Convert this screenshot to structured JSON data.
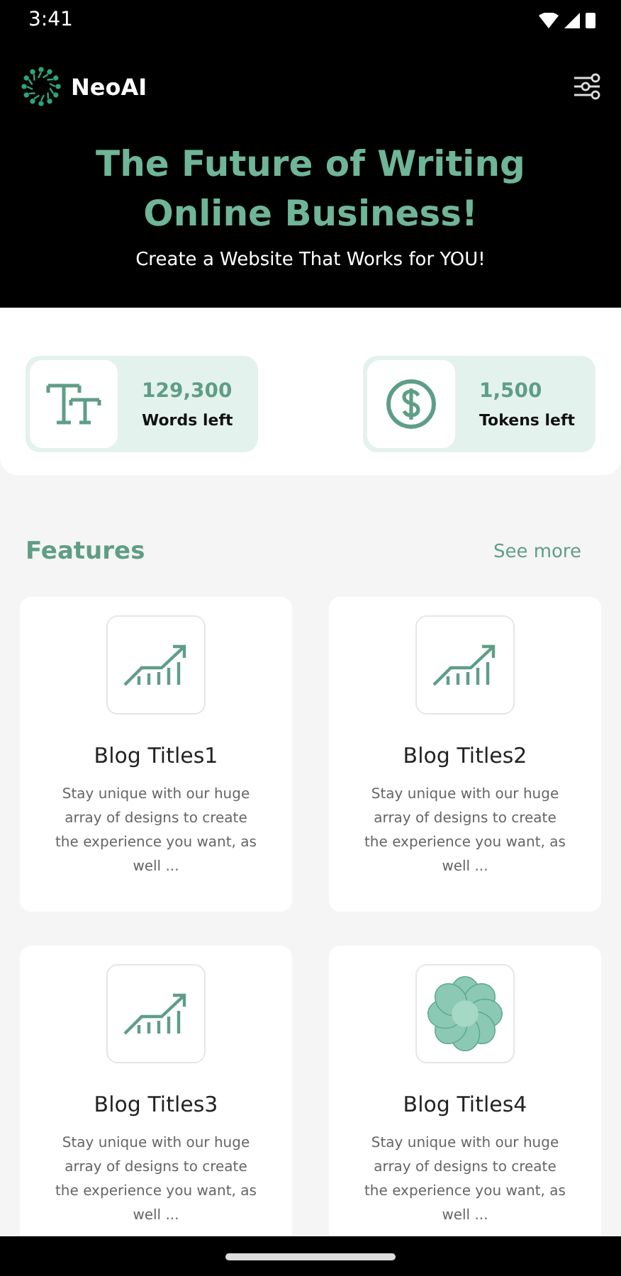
{
  "status_bar": {
    "time": "3:41"
  },
  "header": {
    "brand": "NeoAI",
    "headline": "The Future of Writing Online Business!",
    "tagline": "Create a Website That Works for YOU!"
  },
  "stats": [
    {
      "kind": "text",
      "value": "129,300",
      "label": "Words left"
    },
    {
      "kind": "dollar",
      "value": "1,500",
      "label": "Tokens left"
    }
  ],
  "features": {
    "title": "Features",
    "link": "See more",
    "cards": [
      {
        "kind": "chart",
        "title": "Blog Titles1",
        "description": "Stay unique with our huge array of designs to create the experience you want, as well ..."
      },
      {
        "kind": "chart",
        "title": "Blog Titles2",
        "description": "Stay unique with our huge array of designs to create the experience you want, as well ..."
      },
      {
        "kind": "chart",
        "title": "Blog Titles3",
        "description": "Stay unique with our huge array of designs to create the experience you want, as well ..."
      },
      {
        "kind": "pattern",
        "title": "Blog Titles4",
        "description": "Stay unique with our huge array of designs to create the experience you want, as well ..."
      }
    ]
  }
}
